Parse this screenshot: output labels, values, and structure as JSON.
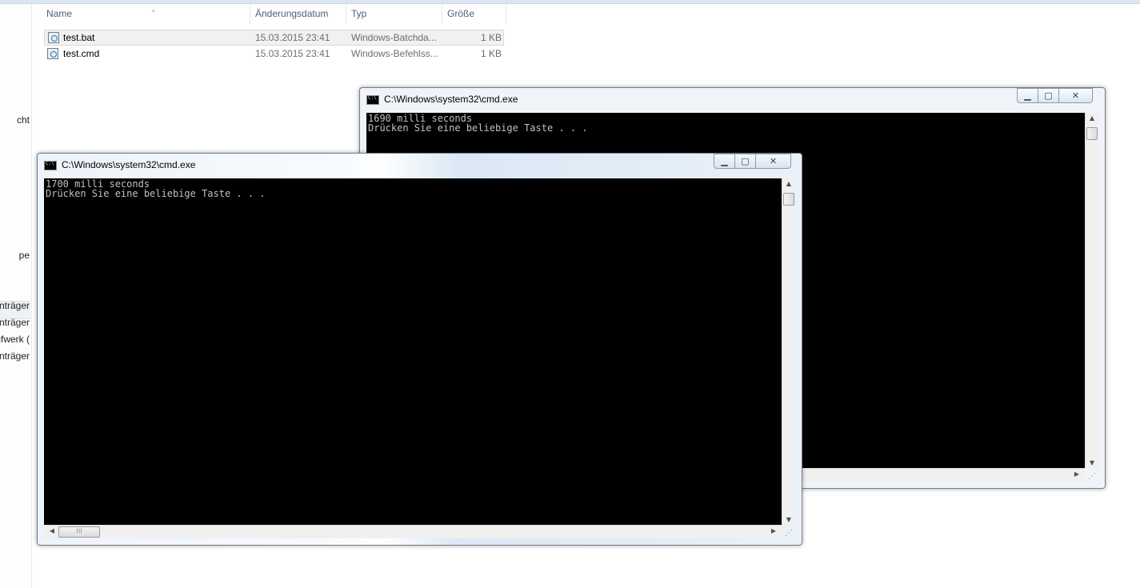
{
  "explorer": {
    "nav_items": [
      {
        "label": "cht"
      },
      {
        "label": "pe"
      },
      {
        "label": "nträger"
      },
      {
        "label": "nträger"
      },
      {
        "label": "ufwerk ("
      },
      {
        "label": "nträger"
      }
    ],
    "columns": {
      "name": "Name",
      "date": "Änderungsdatum",
      "type": "Typ",
      "size": "Größe"
    },
    "files": [
      {
        "name": "test.bat",
        "date": "15.03.2015 23:41",
        "type": "Windows-Batchda...",
        "size": "1 KB",
        "selected": true
      },
      {
        "name": "test.cmd",
        "date": "15.03.2015 23:41",
        "type": "Windows-Befehlss...",
        "size": "1 KB",
        "selected": false
      }
    ]
  },
  "windows": {
    "back": {
      "title": "C:\\Windows\\system32\\cmd.exe",
      "line1": "1690 milli seconds",
      "line2": "Drücken Sie eine beliebige Taste . . ."
    },
    "front": {
      "title": "C:\\Windows\\system32\\cmd.exe",
      "line1": "1700 milli seconds",
      "line2": "Drücken Sie eine beliebige Taste . . ."
    }
  },
  "icons": {
    "minimize": "minimize-icon",
    "maximize": "maximize-icon",
    "close": "close-icon"
  },
  "caption_glyphs": {
    "minimize": "▁",
    "maximize": "▢",
    "close": "✕"
  },
  "scroll_glyphs": {
    "up": "▲",
    "down": "▼",
    "left": "◀",
    "right": "▶",
    "thumb": "⁞⁞⁞"
  }
}
